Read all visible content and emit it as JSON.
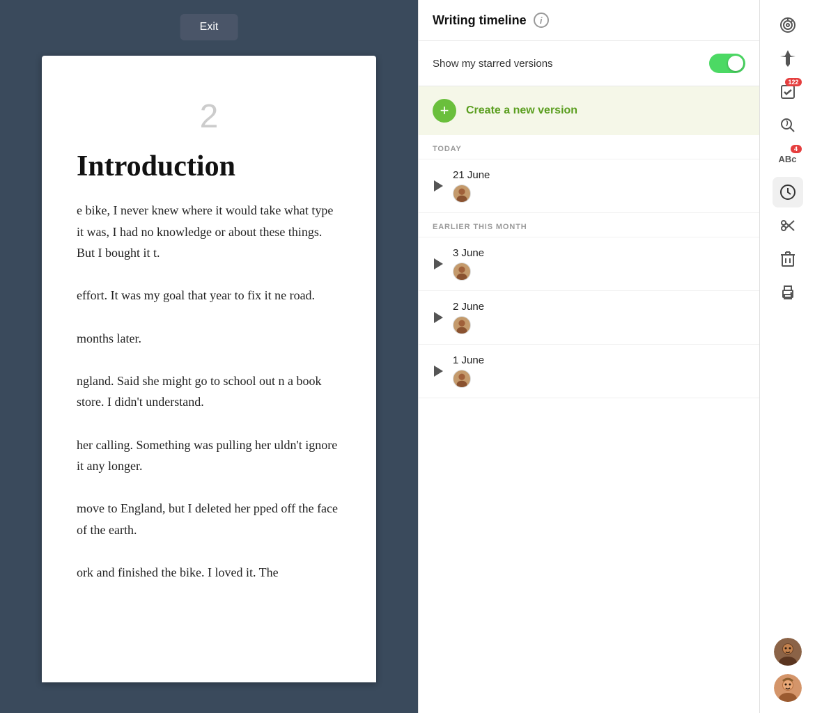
{
  "exit_button": "Exit",
  "document": {
    "page_number": "2",
    "heading": "Introduction",
    "paragraphs": [
      "e bike, I never knew where it would take what type it was, I had no knowledge or about these things. But I bought it t.",
      "effort. It was my goal that year to fix it ne road.",
      "months later.",
      "ngland. Said she might go to school out n a book store. I didn't understand.",
      "her calling. Something was pulling her uldn't ignore it any longer.",
      "move to England, but I deleted her pped off the face of the earth.",
      "ork and finished the bike. I loved it. The"
    ]
  },
  "timeline": {
    "title": "Writing timeline",
    "info_icon": "i",
    "toggle_label": "Show my starred versions",
    "toggle_on": true,
    "create_version_label": "Create a new version",
    "sections": [
      {
        "id": "today",
        "label": "TODAY",
        "entries": [
          {
            "date": "21 June",
            "has_avatar": true
          }
        ]
      },
      {
        "id": "earlier",
        "label": "EARLIER THIS MONTH",
        "entries": [
          {
            "date": "3 June",
            "has_avatar": true
          },
          {
            "date": "2 June",
            "has_avatar": true
          },
          {
            "date": "1 June",
            "has_avatar": true
          }
        ]
      }
    ]
  },
  "sidebar": {
    "icons": [
      {
        "name": "target-icon",
        "symbol": "⊙",
        "badge": null,
        "active": false
      },
      {
        "name": "pin-icon",
        "symbol": "📌",
        "badge": null,
        "active": false
      },
      {
        "name": "checklist-icon",
        "symbol": "✓",
        "badge": "122",
        "active": false
      },
      {
        "name": "search-icon",
        "symbol": "⟳",
        "badge": null,
        "active": false
      },
      {
        "name": "abc-icon",
        "symbol": "ABc",
        "badge": "4",
        "active": false
      },
      {
        "name": "clock-icon",
        "symbol": "🕐",
        "badge": null,
        "active": true
      },
      {
        "name": "scissors-icon",
        "symbol": "✂",
        "badge": null,
        "active": false
      },
      {
        "name": "trash-icon",
        "symbol": "🗑",
        "badge": null,
        "active": false
      },
      {
        "name": "print-icon",
        "symbol": "🖨",
        "badge": null,
        "active": false
      }
    ],
    "users": [
      {
        "name": "user-avatar-1"
      },
      {
        "name": "user-avatar-2"
      }
    ]
  }
}
